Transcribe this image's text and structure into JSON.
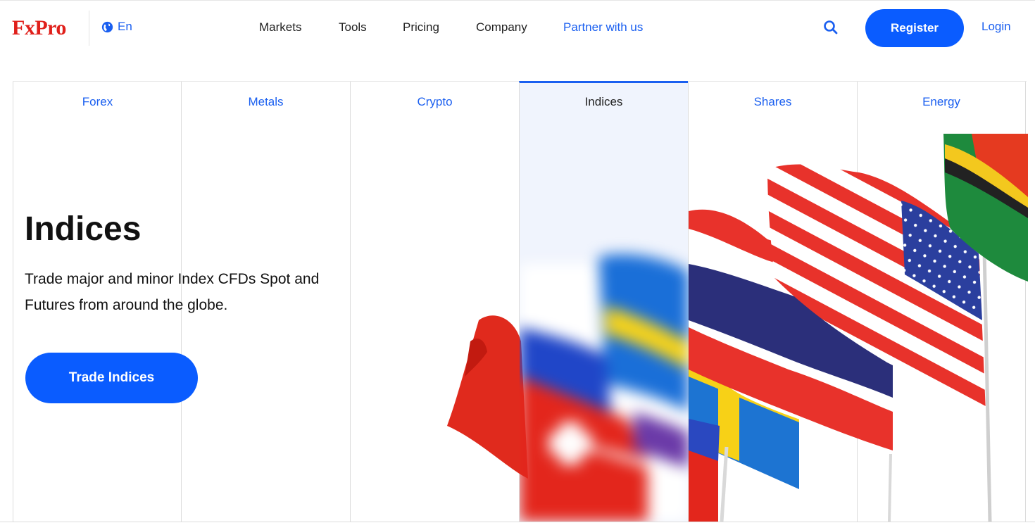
{
  "brand": {
    "logo_text": "FxPro",
    "logo_color": "#e0201b"
  },
  "header": {
    "language": "En",
    "nav": [
      {
        "label": "Markets"
      },
      {
        "label": "Tools"
      },
      {
        "label": "Pricing"
      },
      {
        "label": "Company"
      },
      {
        "label": "Partner with us"
      }
    ],
    "search_icon": "search-icon",
    "register_label": "Register",
    "login_label": "Login"
  },
  "markets": {
    "tabs": [
      {
        "label": "Forex"
      },
      {
        "label": "Metals"
      },
      {
        "label": "Crypto"
      },
      {
        "label": "Indices",
        "active": true
      },
      {
        "label": "Shares"
      },
      {
        "label": "Energy"
      }
    ]
  },
  "hero": {
    "title": "Indices",
    "subtitle": "Trade major and minor Index CFDs Spot and Futures from around the globe.",
    "cta_label": "Trade Indices",
    "image": "national-flags-illustration"
  },
  "colors": {
    "accent": "#0a5cff",
    "link": "#1a5ff0",
    "active_column_bg": "#f0f4fd"
  }
}
